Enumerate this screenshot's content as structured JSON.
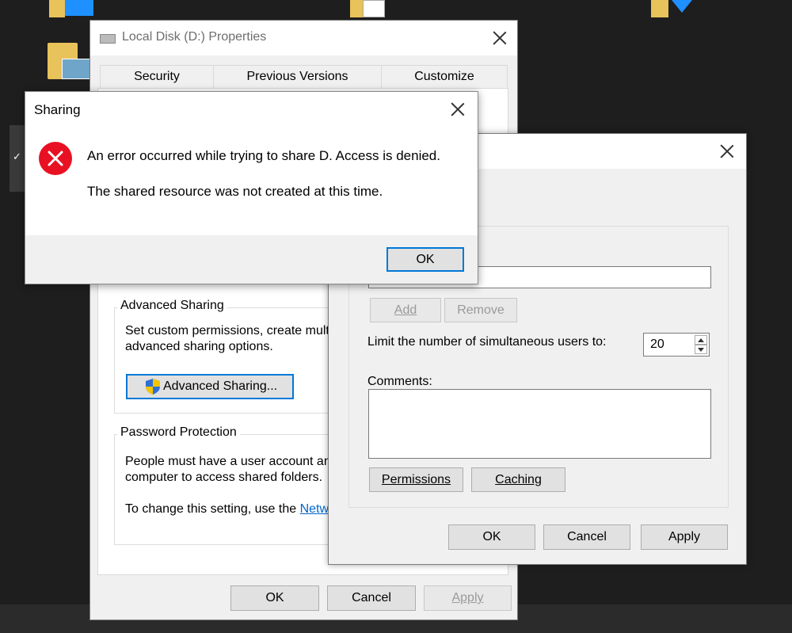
{
  "properties": {
    "title": "Local Disk (D:) Properties",
    "tabs": [
      "Security",
      "Previous Versions",
      "Customize"
    ],
    "advanced_sharing": {
      "group_label": "Advanced Sharing",
      "desc_line1": "Set custom permissions, create multi",
      "desc_line2": "advanced sharing options.",
      "button_label": "Advanced Sharing..."
    },
    "password_protection": {
      "group_label": "Password Protection",
      "desc_line1": "People must have a user account an",
      "desc_line2": "computer to access shared folders.",
      "change_text": "To change this setting, use the ",
      "link_text": "Netw"
    },
    "buttons": {
      "ok": "OK",
      "cancel": "Cancel",
      "apply": "Apply"
    }
  },
  "advanced": {
    "add_label": "Add",
    "remove_label": "Remove",
    "limit_label": "Limit the number of simultaneous users to:",
    "limit_value": "20",
    "comments_label": "Comments:",
    "permissions_label": "Permissions",
    "caching_label": "Caching",
    "buttons": {
      "ok": "OK",
      "cancel": "Cancel",
      "apply": "Apply"
    }
  },
  "error_dialog": {
    "title": "Sharing",
    "message_line1": "An error occurred while trying to share D. Access is denied.",
    "message_line2": "The shared resource was not created at this time.",
    "ok_label": "OK",
    "icon": "error-icon",
    "icon_color": "#e81123"
  }
}
